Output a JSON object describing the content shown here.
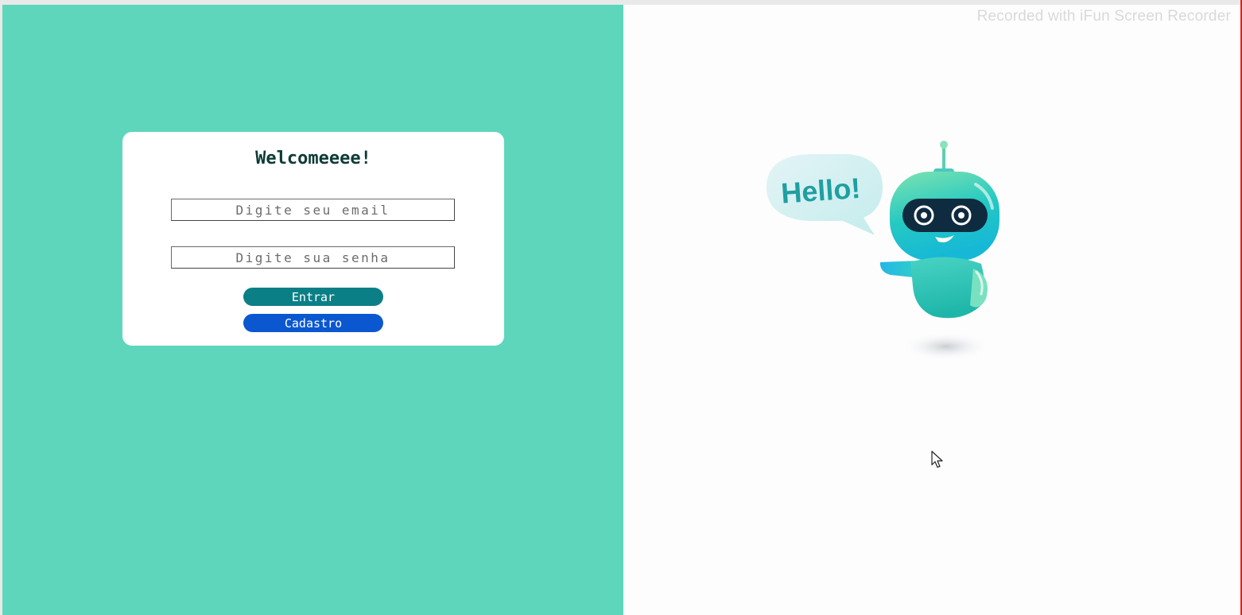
{
  "watermark": "Recorded with iFun Screen Recorder",
  "login": {
    "title": "Welcomeeee!",
    "email_placeholder": "Digite seu email",
    "password_placeholder": "Digite sua senha",
    "enter_label": "Entrar",
    "register_label": "Cadastro"
  },
  "illustration": {
    "speech_text": "Hello!",
    "icon": "robot-mascot"
  },
  "colors": {
    "left_panel": "#5ed6bb",
    "enter_button": "#0b7f86",
    "register_button": "#0b57d0",
    "title_text": "#0d3b36"
  }
}
